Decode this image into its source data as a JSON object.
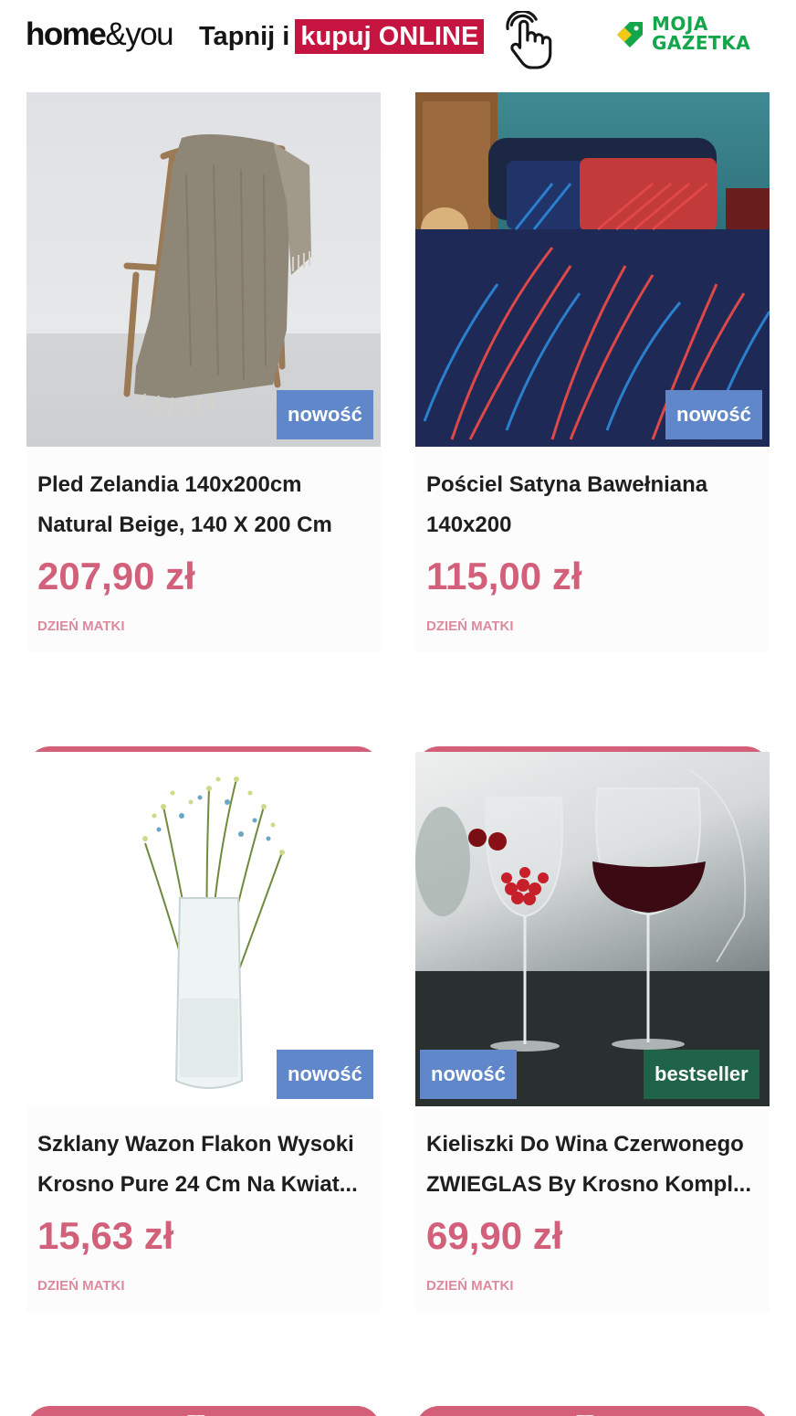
{
  "header": {
    "logo_text_bold": "home",
    "logo_text_light": "&you",
    "tagline_prefix": "Tapnij i",
    "tagline_highlight": "kupuj ONLINE",
    "partner_logo_line1": "MOJA",
    "partner_logo_line2": "GAZETKA"
  },
  "colors": {
    "accent_button": "#d35f78",
    "price": "#d2607a",
    "badge_new": "#5f87c9",
    "badge_bestseller": "#1f6448",
    "tagline_highlight_bg": "#c4143f",
    "partner_green": "#13a64a"
  },
  "products": [
    {
      "title": "Pled Zelandia 140x200cm Natural Beige, 140 X 200 Cm",
      "price": "207,90 zł",
      "tag": "DZIEŃ MATKI",
      "badges": [
        "nowość"
      ],
      "image": "beige-throw-on-chair",
      "button_icon": "tap-hand-icon"
    },
    {
      "title": "Pościel Satyna Bawełniana 140x200",
      "price": "115,00 zł",
      "tag": "DZIEŃ MATKI",
      "badges": [
        "nowość"
      ],
      "image": "palm-leaf-bedding",
      "button_icon": "tap-hand-icon"
    },
    {
      "title": "Szklany Wazon Flakon Wysoki Krosno Pure 24 Cm Na Kwiat...",
      "price": "15,63 zł",
      "tag": "DZIEŃ MATKI",
      "badges": [
        "nowość"
      ],
      "image": "glass-vase-with-flowers",
      "button_icon": "tap-hand-icon"
    },
    {
      "title": "Kieliszki Do Wina Czerwonego ZWIEGLAS By Krosno Kompl...",
      "price": "69,90 zł",
      "tag": "DZIEŃ MATKI",
      "badges": [
        "nowość",
        "bestseller"
      ],
      "image": "red-wine-glasses",
      "button_icon": "tap-hand-icon"
    }
  ]
}
